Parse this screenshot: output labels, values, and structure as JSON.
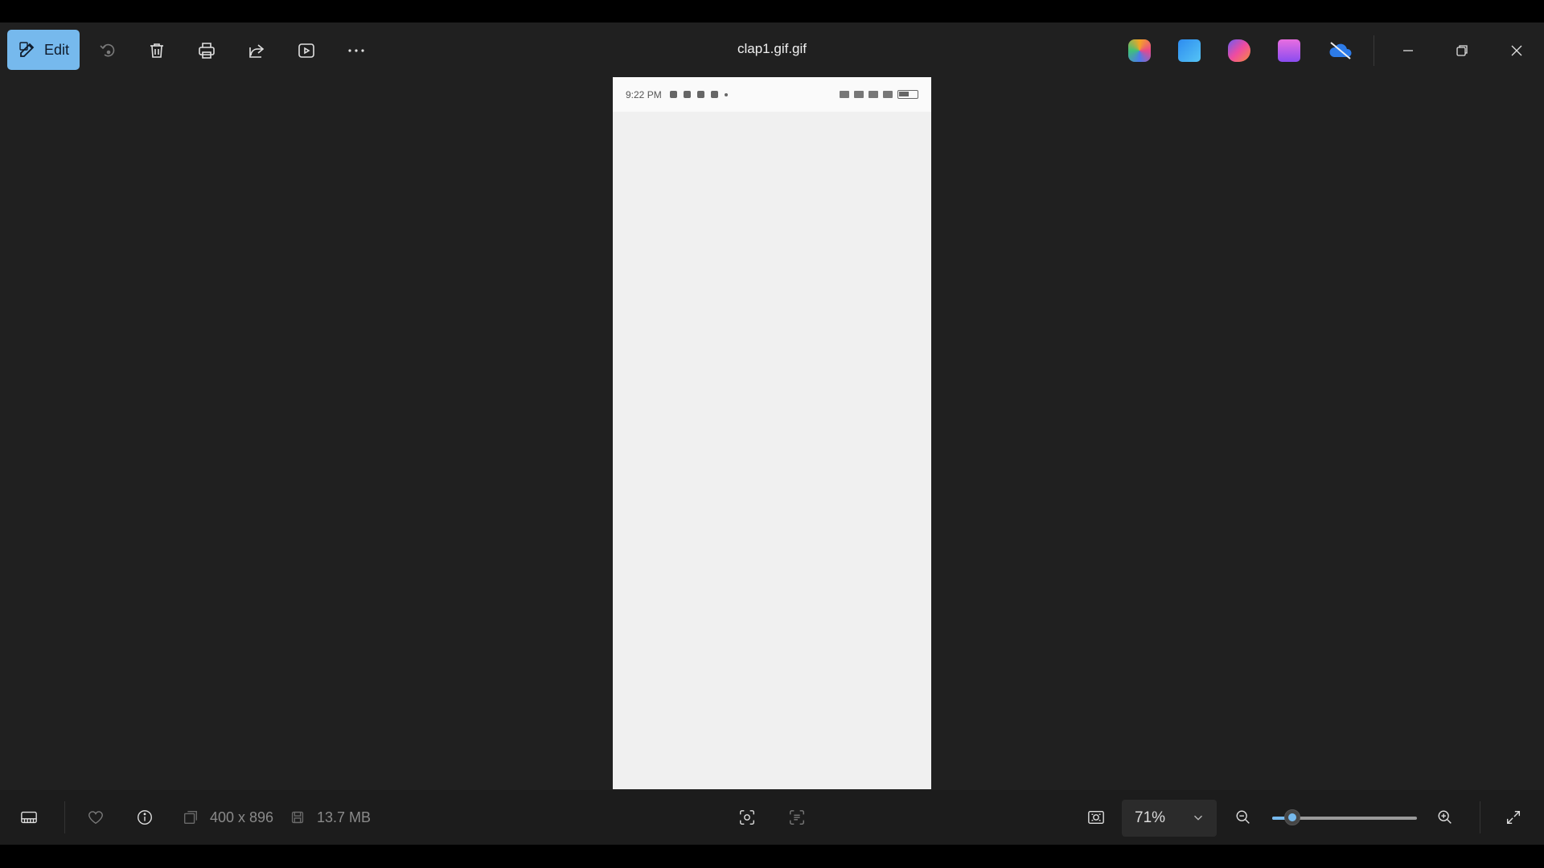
{
  "toolbar": {
    "edit_label": "Edit",
    "title": "clap1.gif.gif",
    "icons": [
      "edit-icon",
      "rotate-icon",
      "delete-icon",
      "print-icon",
      "share-icon",
      "slideshow-icon",
      "more-icon"
    ],
    "apps": [
      "copilot-icon",
      "designer-icon",
      "clipchamp-icon",
      "photos-icon",
      "onedrive-icon"
    ],
    "window": [
      "minimize-icon",
      "restore-icon",
      "close-icon"
    ]
  },
  "phone": {
    "time": "9:22 PM"
  },
  "statusbar": {
    "dimensions": "400 x 896",
    "file_size": "13.7 MB",
    "zoom": "71%",
    "zoom_fraction": 0.14
  },
  "colors": {
    "accent": "#76b9ed",
    "background": "#202020",
    "statusbar": "#1c1c1c"
  }
}
